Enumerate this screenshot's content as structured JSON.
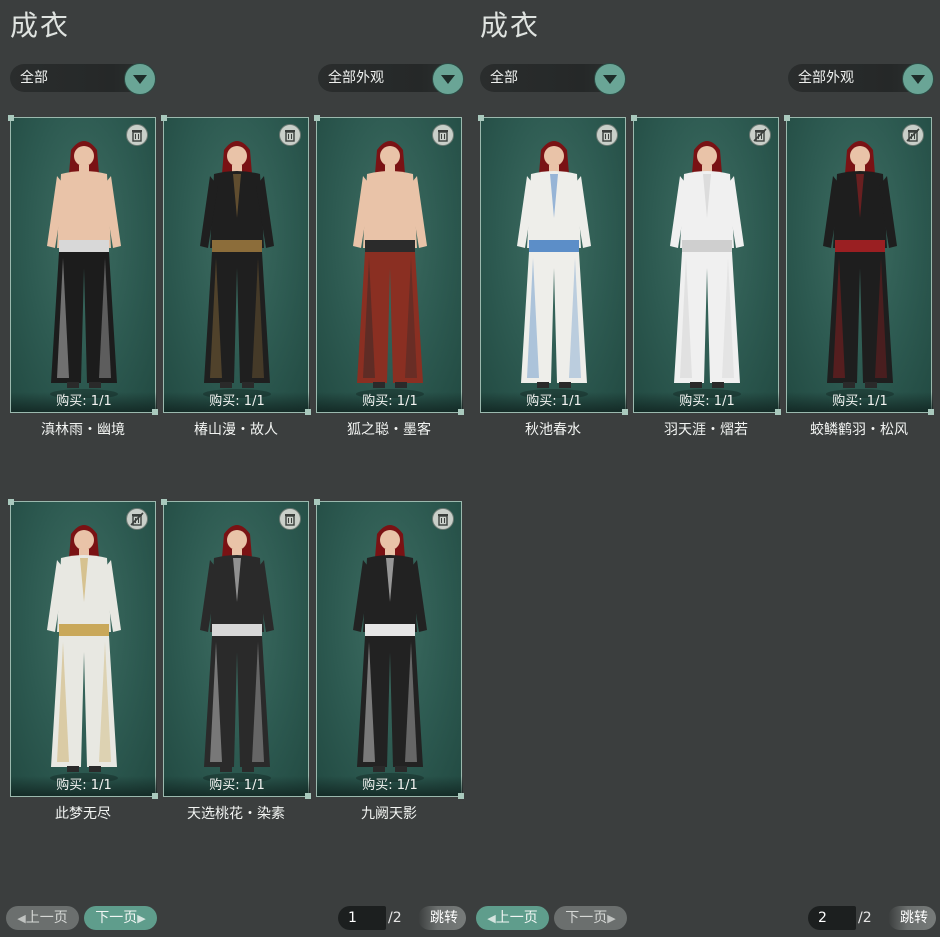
{
  "left": {
    "title": "成衣",
    "dropdown_type": "全部",
    "dropdown_filter": "全部外观",
    "cards": [
      {
        "name": "滇林雨・幽境",
        "buy": "购买: 1/1",
        "outfit": "shirtless-black",
        "icon": "trash-icon",
        "color": "#1c1c1c",
        "accent": "#d8d8d8"
      },
      {
        "name": "椿山漫・故人",
        "buy": "购买: 1/1",
        "outfit": "black-gold",
        "icon": "trash-icon",
        "color": "#1f1f1f",
        "accent": "#8c6d3a"
      },
      {
        "name": "狐之聪・墨客",
        "buy": "购买: 1/1",
        "outfit": "shirtless-red",
        "icon": "trash-icon",
        "color": "#8a2f22",
        "accent": "#2b2b2b"
      },
      {
        "name": "此梦无尽",
        "buy": "购买: 1/1",
        "outfit": "white-gold",
        "icon": "disabled-trash-icon",
        "color": "#e8e8e2",
        "accent": "#c9a85a"
      },
      {
        "name": "天选桃花・染素",
        "buy": "购买: 1/1",
        "outfit": "white-black",
        "icon": "trash-icon",
        "color": "#2a2a2a",
        "accent": "#d7d7d7"
      },
      {
        "name": "九阙天影",
        "buy": "购买: 1/1",
        "outfit": "black-white",
        "icon": "trash-icon",
        "color": "#222222",
        "accent": "#e6e6e6"
      }
    ],
    "prev_label": "上一页",
    "next_label": "下一页",
    "page": "1",
    "total": "/2",
    "jump_label": "跳转"
  },
  "right": {
    "title": "成衣",
    "dropdown_type": "全部",
    "dropdown_filter": "全部外观",
    "cards": [
      {
        "name": "秋池春水",
        "buy": "购买: 1/1",
        "outfit": "white-blue",
        "icon": "trash-icon",
        "color": "#eeeeea",
        "accent": "#5c8ec8"
      },
      {
        "name": "羽天涯・熠若",
        "buy": "购买: 1/1",
        "outfit": "all-white",
        "icon": "disabled-trash-icon",
        "color": "#f0f0f0",
        "accent": "#cfcfcf"
      },
      {
        "name": "蛟鳞鹤羽・松风",
        "buy": "购买: 1/1",
        "outfit": "black-red",
        "icon": "disabled-trash-icon",
        "color": "#1e1e1e",
        "accent": "#9a1f22"
      }
    ],
    "prev_label": "上一页",
    "next_label": "下一页",
    "page": "2",
    "total": "/2",
    "jump_label": "跳转"
  }
}
